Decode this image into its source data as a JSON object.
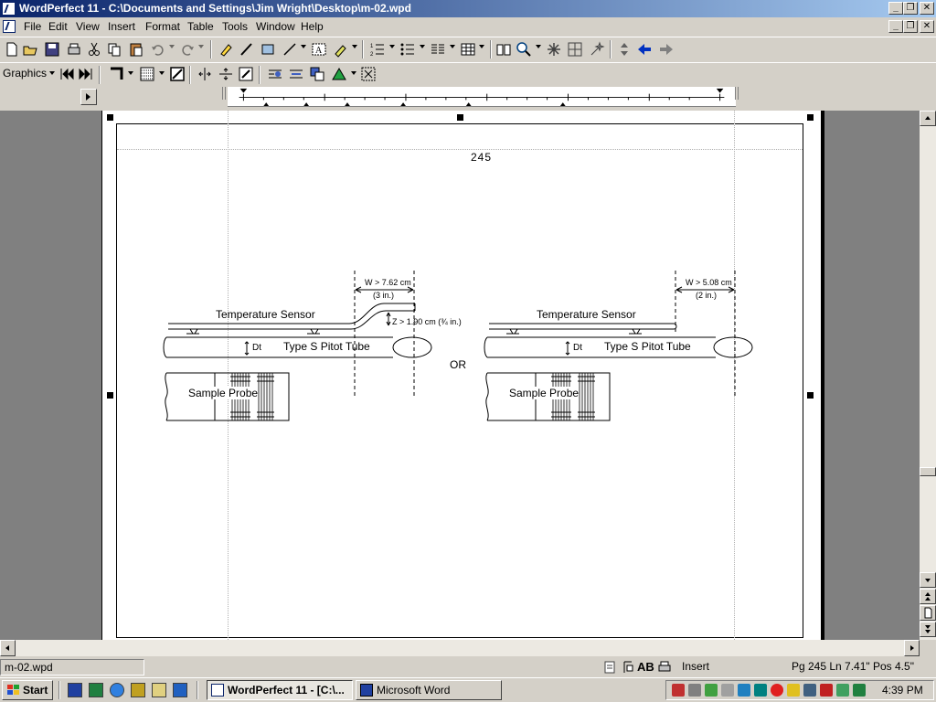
{
  "window": {
    "title": "WordPerfect 11 - C:\\Documents and Settings\\Jim Wright\\Desktop\\m-02.wpd",
    "minimize": "_",
    "restore": "❐",
    "close": "✕"
  },
  "menu": [
    "File",
    "Edit",
    "View",
    "Insert",
    "Format",
    "Table",
    "Tools",
    "Window",
    "Help"
  ],
  "toolbar2": {
    "label": "Graphics"
  },
  "page": {
    "number": "245",
    "figure": {
      "left": {
        "temp_sensor": "Temperature Sensor",
        "pitot": "Type S Pitot Tube",
        "probe": "Sample Probe",
        "w_dim": "W > 7.62 cm",
        "w_dim_in": "(3 in.)",
        "z_dim": "Z > 1.90 cm (¾ in.)",
        "dt": "Dt"
      },
      "or": "OR",
      "right": {
        "temp_sensor": "Temperature Sensor",
        "pitot": "Type S Pitot Tube",
        "probe": "Sample Probe",
        "w_dim": "W > 5.08 cm",
        "w_dim_in": "(2 in.)",
        "dt": "Dt"
      }
    }
  },
  "status": {
    "filename": "m-02.wpd",
    "ab": "AB",
    "mode": "Insert",
    "position": "Pg 245 Ln 7.41\" Pos 4.5\""
  },
  "taskbar": {
    "start": "Start",
    "tasks": [
      "WordPerfect 11 - [C:\\...",
      "Microsoft Word"
    ],
    "clock": "4:39 PM"
  }
}
